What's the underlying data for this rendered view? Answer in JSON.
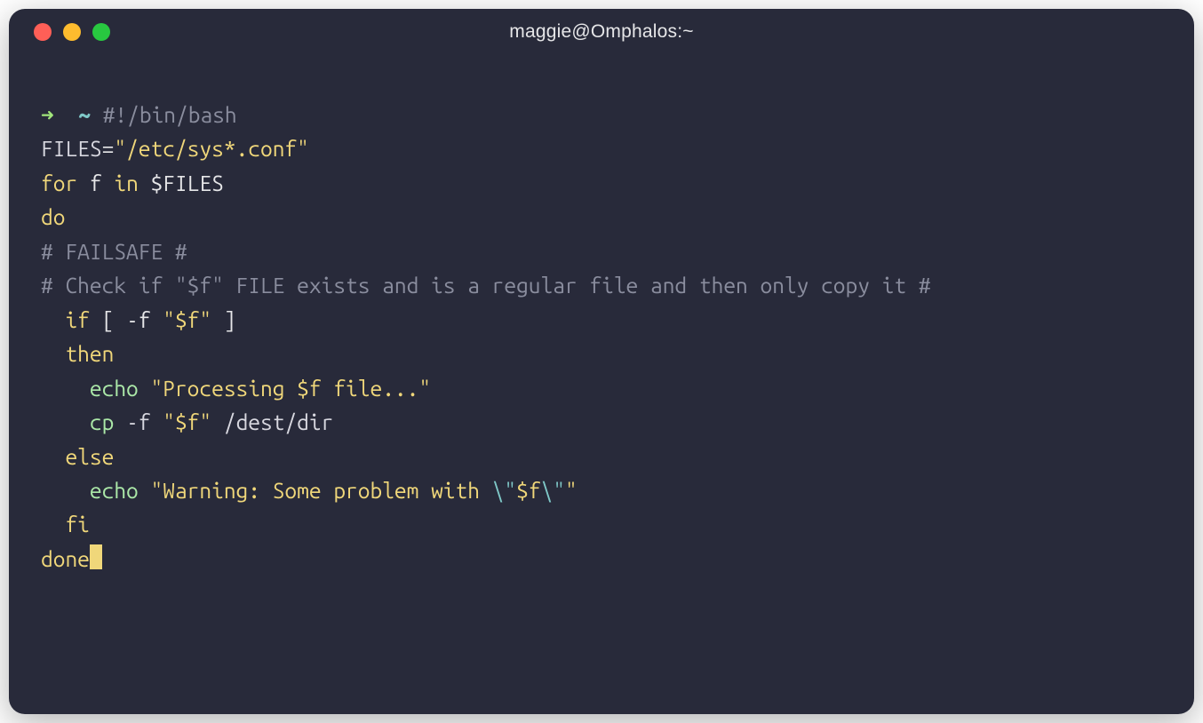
{
  "window": {
    "title": "maggie@Omphalos:~"
  },
  "prompt": {
    "arrow": "➜",
    "tilde": "~"
  },
  "code": {
    "line1_comment": "#!/bin/bash",
    "line2_var": "FILES",
    "line2_eq": "=",
    "line2_str": "\"/etc/sys*.conf\"",
    "line3_for": "for",
    "line3_f": " f ",
    "line3_in": "in",
    "line3_var": " $FILES",
    "line4_do": "do",
    "line5_comment": "# FAILSAFE #",
    "line6_comment": "# Check if \"$f\" FILE exists and is a regular file and then only copy it #",
    "line7_indent": "  ",
    "line7_if": "if",
    "line7_test": " [ -f ",
    "line7_str": "\"$f\"",
    "line7_end": " ]",
    "line8_indent": "  ",
    "line8_then": "then",
    "line9_indent": "    ",
    "line9_echo": "echo",
    "line9_sp": " ",
    "line9_str": "\"Processing $f file...\"",
    "line10_indent": "    ",
    "line10_cp": "cp",
    "line10_flag": " -f ",
    "line10_str": "\"$f\"",
    "line10_path": " /dest/dir",
    "line11_indent": "  ",
    "line11_else": "else",
    "line12_indent": "    ",
    "line12_echo": "echo",
    "line12_sp": " ",
    "line12_str1": "\"Warning: Some problem with ",
    "line12_esc1": "\\\"",
    "line12_str2": "$f",
    "line12_esc2": "\\\"",
    "line12_str3": "\"",
    "line13_indent": "  ",
    "line13_fi": "fi",
    "line14_done": "done"
  }
}
